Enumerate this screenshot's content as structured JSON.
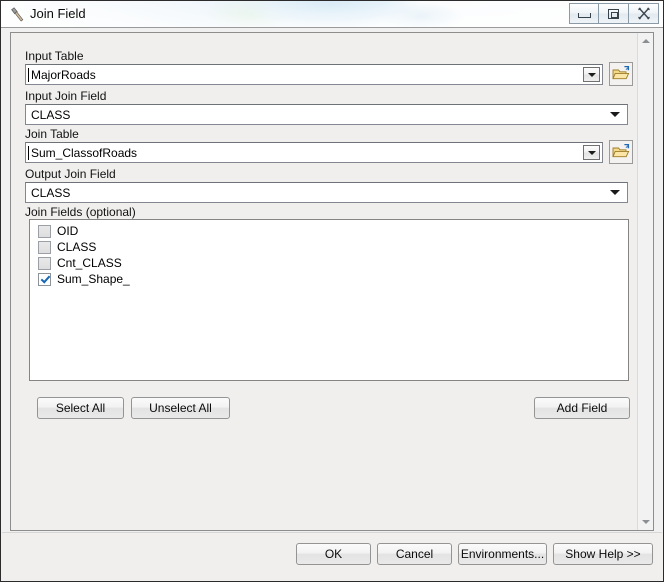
{
  "window": {
    "title": "Join Field",
    "icon": "hammer-tool-icon",
    "controls": {
      "minimize": "Minimize",
      "restore": "Restore",
      "close": "Close"
    }
  },
  "form": {
    "input_table": {
      "label": "Input Table",
      "value": "MajorRoads",
      "browse_tooltip": "Browse"
    },
    "input_join_field": {
      "label": "Input Join Field",
      "value": "CLASS"
    },
    "join_table": {
      "label": "Join Table",
      "value": "Sum_ClassofRoads",
      "browse_tooltip": "Browse"
    },
    "output_join_field": {
      "label": "Output Join Field",
      "value": "CLASS"
    },
    "join_fields": {
      "label": "Join Fields (optional)",
      "items": [
        {
          "name": "OID",
          "checked": false
        },
        {
          "name": "CLASS",
          "checked": false
        },
        {
          "name": "Cnt_CLASS",
          "checked": false
        },
        {
          "name": "Sum_Shape_",
          "checked": true
        }
      ]
    }
  },
  "list_actions": {
    "select_all": "Select All",
    "unselect_all": "Unselect All",
    "add_field": "Add Field"
  },
  "footer": {
    "ok": "OK",
    "cancel": "Cancel",
    "environments": "Environments...",
    "show_help": "Show Help >>"
  },
  "colors": {
    "dialog_background": "#f0efee",
    "field_background": "#ffffff",
    "check_accent": "#1767b5",
    "folder_icon": "#f0c14b",
    "border": "#848484"
  }
}
